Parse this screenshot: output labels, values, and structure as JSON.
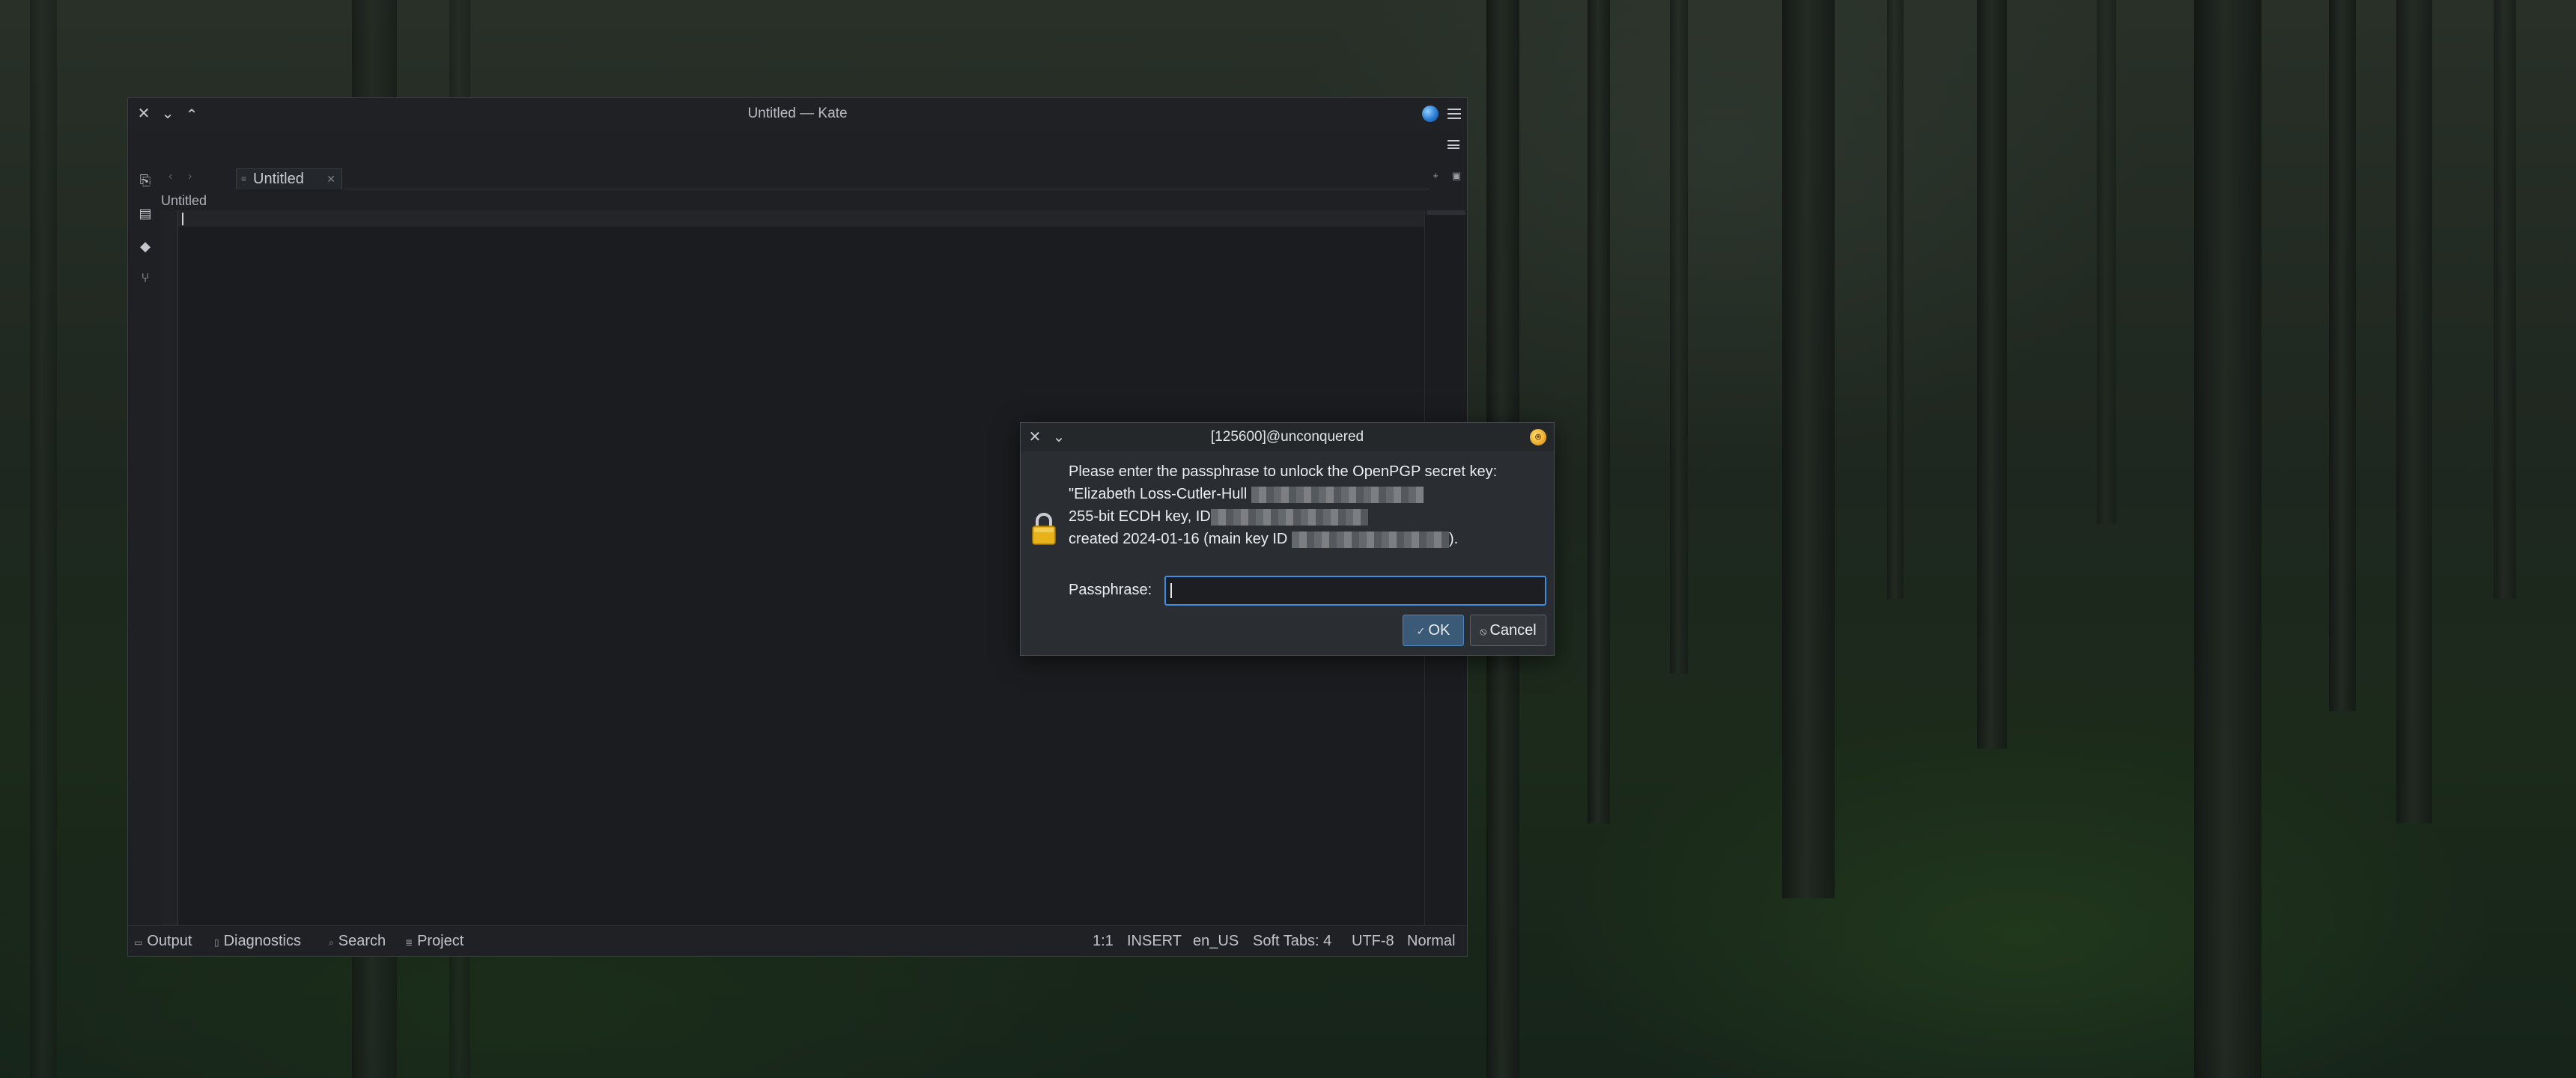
{
  "kate": {
    "window_title": "Untitled — Kate",
    "tab_label": "Untitled",
    "breadcrumb": "Untitled",
    "status": {
      "output": "Output",
      "diagnostics": "Diagnostics",
      "search": "Search",
      "project": "Project",
      "cursor_pos": "1:1",
      "mode": "INSERT",
      "language": "en_US",
      "indent": "Soft Tabs: 4",
      "encoding": "UTF-8",
      "input_mode": "Normal"
    }
  },
  "pinentry": {
    "title": "[125600]@unconquered",
    "message_line1": "Please enter the passphrase to unlock the OpenPGP secret key:",
    "message_line2": "\"Elizabeth Loss-Cutler-Hull",
    "message_line3": "255-bit ECDH key, ID",
    "message_line4_prefix": "created 2024-01-16 (main key ID",
    "message_line4_suffix": ").",
    "passphrase_label": "Passphrase:",
    "passphrase_value": "",
    "ok_label": "OK",
    "cancel_label": "Cancel"
  }
}
